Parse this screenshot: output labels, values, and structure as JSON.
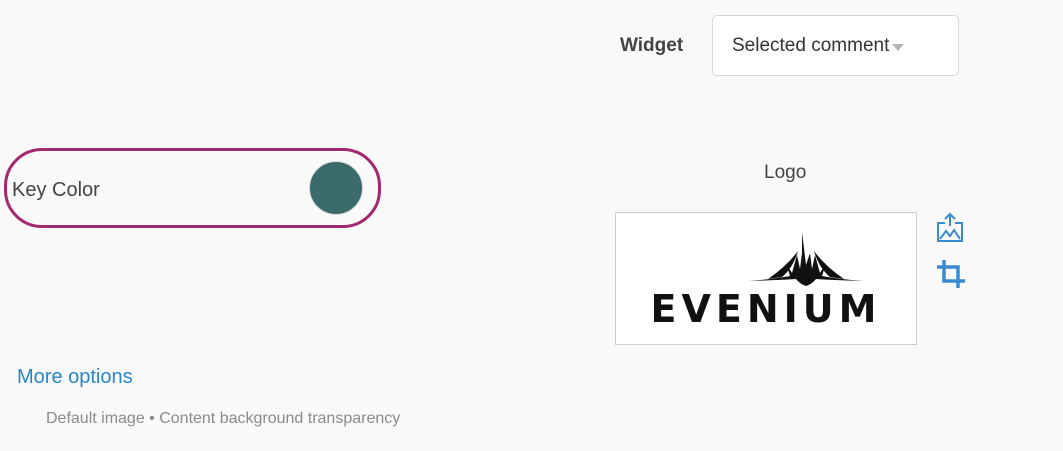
{
  "widget": {
    "label": "Widget",
    "selected": "Selected comment"
  },
  "key_color": {
    "label": "Key Color",
    "value": "#3a6a6a",
    "highlight_color": "#a3286f"
  },
  "logo": {
    "label": "Logo",
    "image_text": "EVENIUM",
    "upload_icon": "image-upload-icon",
    "crop_icon": "crop-icon"
  },
  "more_options": {
    "link_label": "More options",
    "summary": "Default image • Content background transparency"
  },
  "colors": {
    "link": "#2a86c7",
    "icon": "#3a8ad0"
  }
}
